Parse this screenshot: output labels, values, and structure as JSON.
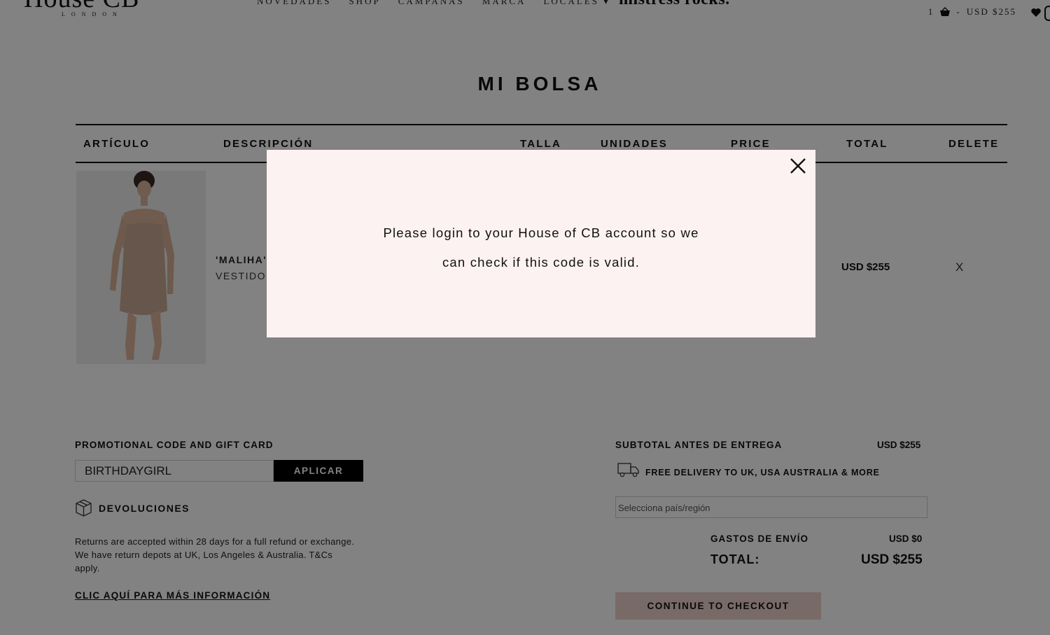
{
  "header": {
    "logo_text": "House CB",
    "logo_sub": "LONDON",
    "nav": [
      "NOVEDADES",
      "SHOP",
      "CAMPAÑAS",
      "MARCA",
      "LOCALES"
    ],
    "nav_extra": "mistress rocks.",
    "cart_count": "1",
    "cart_sep": "-",
    "cart_total": "USD $255"
  },
  "page_title": "MI BOLSA",
  "table": {
    "headers": {
      "articulo": "ARTÍCULO",
      "descripcion": "DESCRIPCIÓN",
      "talla": "TALLA",
      "unidades": "UNIDADES",
      "price": "PRICE",
      "total": "TOTAL",
      "delete": "DELETE"
    },
    "row": {
      "name": "'MALIHA'",
      "type": "VESTIDO",
      "total": "USD $255",
      "delete": "X"
    }
  },
  "promo": {
    "label": "PROMOTIONAL CODE AND GIFT CARD",
    "value": "BIRTHDAYGIRL",
    "button": "APLICAR"
  },
  "returns": {
    "title": "DEVOLUCIONES",
    "line1": "Returns are accepted within 28 days for a full refund or exchange.",
    "line2": "We have return depots at UK, Los Angeles & Australia. T&Cs",
    "line3": "apply.",
    "link": "CLIC AQUÍ PARA MÁS INFORMACIÓN"
  },
  "summary": {
    "subtotal_label": "SUBTOTAL ANTES DE ENTREGA",
    "subtotal_value": "USD $255",
    "delivery_text": "FREE DELIVERY TO UK, USA AUSTRALIA & MORE",
    "country_placeholder": "Selecciona país/región",
    "shipping_label": "GASTOS DE ENVÍO",
    "shipping_value": "USD $0",
    "total_label": "TOTAL:",
    "total_value": "USD $255",
    "checkout": "CONTINUE TO CHECKOUT"
  },
  "modal": {
    "line1": "Please login to your House of CB account so we",
    "line2": "can check if this code is valid."
  },
  "colors": {
    "overlay": "#000000",
    "modal_bg": "#fcf2f1",
    "checkout_bg": "#ecd0c8",
    "button_black": "#000000"
  }
}
